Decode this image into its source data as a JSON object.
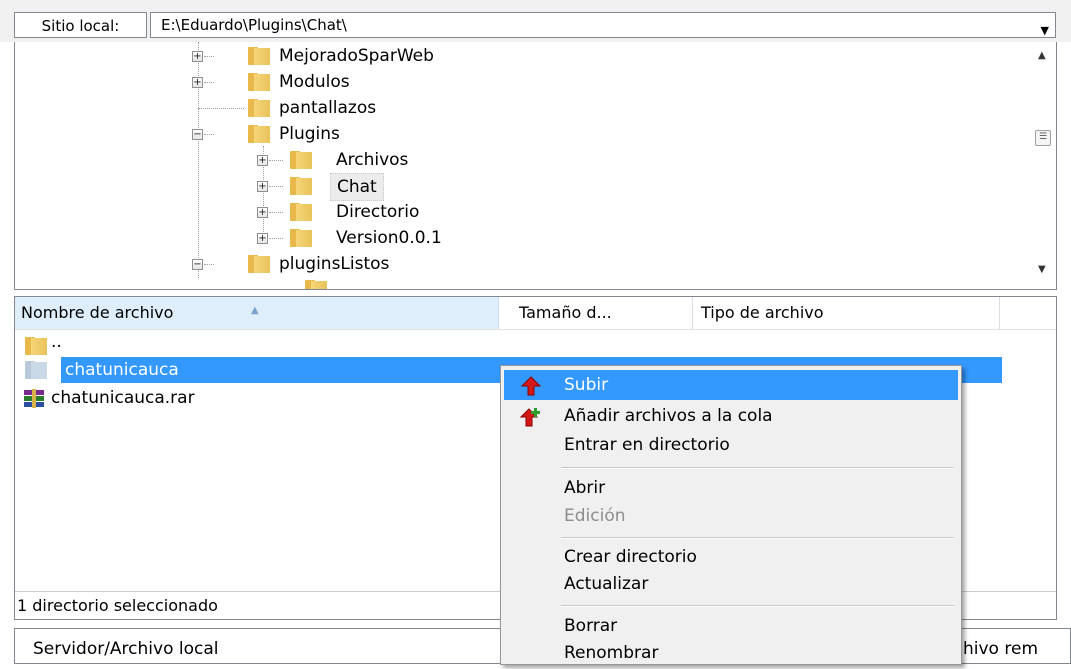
{
  "path_bar": {
    "label": "Sitio local:",
    "path": "E:\\Eduardo\\Plugins\\Chat\\"
  },
  "tree": {
    "items": [
      {
        "label": "MejoradoSparWeb",
        "expander": "+"
      },
      {
        "label": "Modulos",
        "expander": "+"
      },
      {
        "label": "pantallazos",
        "expander": ""
      },
      {
        "label": "Plugins",
        "expander": "−"
      },
      {
        "label": "Archivos",
        "expander": "+"
      },
      {
        "label": "Chat",
        "expander": "+"
      },
      {
        "label": "Directorio",
        "expander": "+"
      },
      {
        "label": "Version0.0.1",
        "expander": "+"
      },
      {
        "label": "pluginsListos",
        "expander": "−"
      }
    ]
  },
  "file_list": {
    "columns": [
      "Nombre de archivo",
      "Tamaño d...",
      "Tipo de archivo"
    ],
    "rows": [
      {
        "name": "..",
        "icon": "folder-icon"
      },
      {
        "name": "chatunicauca",
        "icon": "folder-icon",
        "selected": true
      },
      {
        "name": "chatunicauca.rar",
        "icon": "rar-archive-icon"
      }
    ],
    "status": "1 directorio seleccionado"
  },
  "bottom_bar": {
    "left_label": "Servidor/Archivo local",
    "right_label": "hivo rem"
  },
  "context_menu": {
    "items": [
      {
        "label": "Subir",
        "highlighted": true,
        "icon": "upload-arrow-icon"
      },
      {
        "label": "Añadir archivos a la cola",
        "icon": "add-to-queue-icon"
      },
      {
        "label": "Entrar en directorio"
      },
      {
        "label": "Abrir"
      },
      {
        "label": "Edición",
        "disabled": true
      },
      {
        "label": "Crear directorio"
      },
      {
        "label": "Actualizar"
      },
      {
        "label": "Borrar"
      },
      {
        "label": "Renombrar"
      }
    ]
  },
  "colors": {
    "selection": "#3399ff",
    "header_sorted": "#dfeefb",
    "folder": "#e9c25a",
    "menu_bg": "#f0f0f0"
  }
}
